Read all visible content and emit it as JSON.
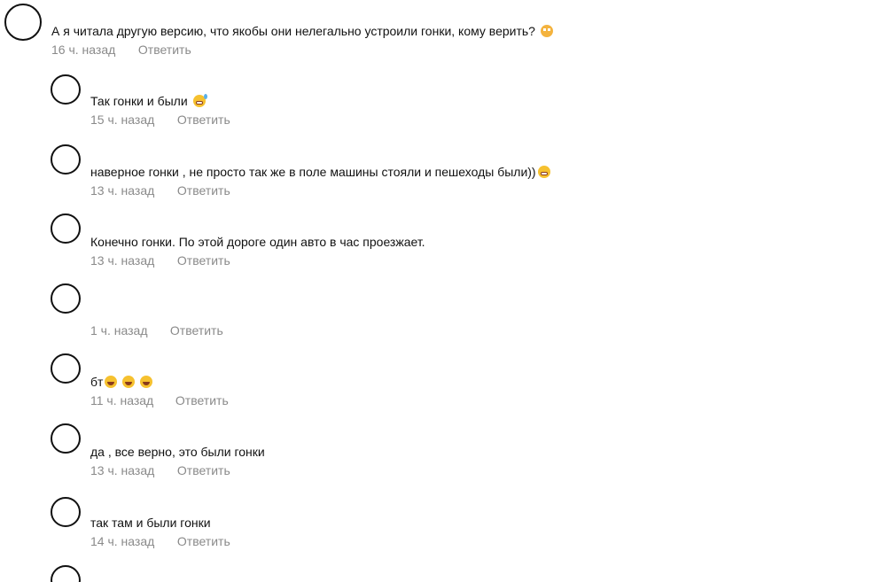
{
  "comments": [
    {
      "text": "А я читала другую версию, что якобы они нелегально устроили гонки, кому верить?",
      "emoji": "flushed-face-icon",
      "time": "16 ч. назад",
      "reply": "Ответить"
    },
    {
      "text": "Так гонки и были",
      "emoji": "grinning-sweat-face-icon",
      "time": "15 ч. назад",
      "reply": "Ответить"
    },
    {
      "text": "наверное гонки , не просто так же в поле машины стояли и пешеходы были))",
      "emoji": "grimacing-face-icon",
      "time": "13 ч. назад",
      "reply": "Ответить"
    },
    {
      "text": "Конечно гонки. По этой дороге один авто в час проезжает.",
      "time": "13 ч. назад",
      "reply": "Ответить"
    },
    {
      "text": "",
      "time": "1 ч. назад",
      "reply": "Ответить"
    },
    {
      "text": "бт",
      "emoji": "tears-of-joy-face-icon",
      "time": "11 ч. назад",
      "reply": "Ответить"
    },
    {
      "text": "да , все верно, это были гонки",
      "time": "13 ч. назад",
      "reply": "Ответить"
    },
    {
      "text": "так там и были гонки",
      "time": "14 ч. назад",
      "reply": "Ответить"
    }
  ]
}
